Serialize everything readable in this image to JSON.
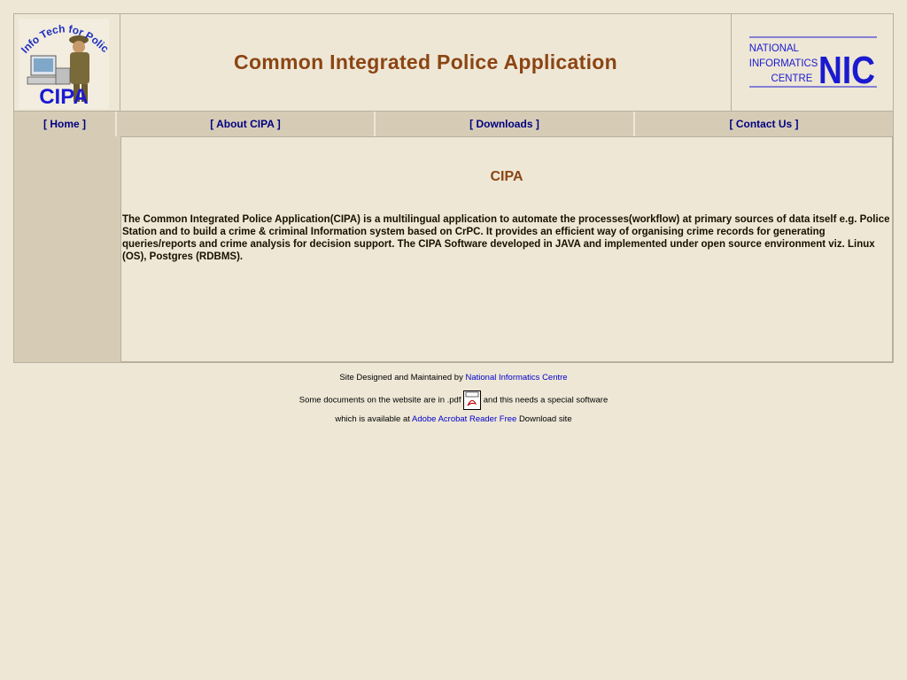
{
  "header": {
    "logo_text_top": "Info Tech for Police",
    "logo_text_main": "CIPA",
    "title": "Common Integrated Police Application",
    "nic_logo_line1": "NATIONAL",
    "nic_logo_line2": "INFORMATICS",
    "nic_logo_line3": "CENTRE",
    "nic_logo_mark": "NIC"
  },
  "nav": {
    "items": [
      {
        "label": "[ Home ]"
      },
      {
        "label": "[ About CIPA ]"
      },
      {
        "label": "[ Downloads ]"
      },
      {
        "label": "[ Contact Us ]"
      }
    ]
  },
  "content": {
    "heading": "CIPA",
    "body": "The Common Integrated Police Application(CIPA) is a multilingual application to automate the processes(workflow) at primary sources of data itself e.g. Police Station and to build a crime & criminal Information system based on CrPC. It provides an efficient way of organising crime records for generating queries/reports and crime analysis for decision support. The CIPA Software developed in JAVA and implemented under open source environment viz. Linux (OS), Postgres (RDBMS)."
  },
  "footer": {
    "designed_by_prefix": "Site Designed and Maintained by",
    "designed_by_link": "National Informatics Centre",
    "pdf_text_before": "Some documents on the website are in .pdf",
    "pdf_text_after": "and this needs a special software",
    "available_prefix": "which is available at",
    "acrobat_link": "Adobe Acrobat Reader Free",
    "available_suffix": "Download site"
  },
  "colors": {
    "background": "#EEE7D6",
    "nav_background": "#D6CCB6",
    "title_color": "#8B4513",
    "nav_link": "#000080",
    "footer_link": "#0000CC",
    "nic_blue": "#1A1AD0"
  }
}
